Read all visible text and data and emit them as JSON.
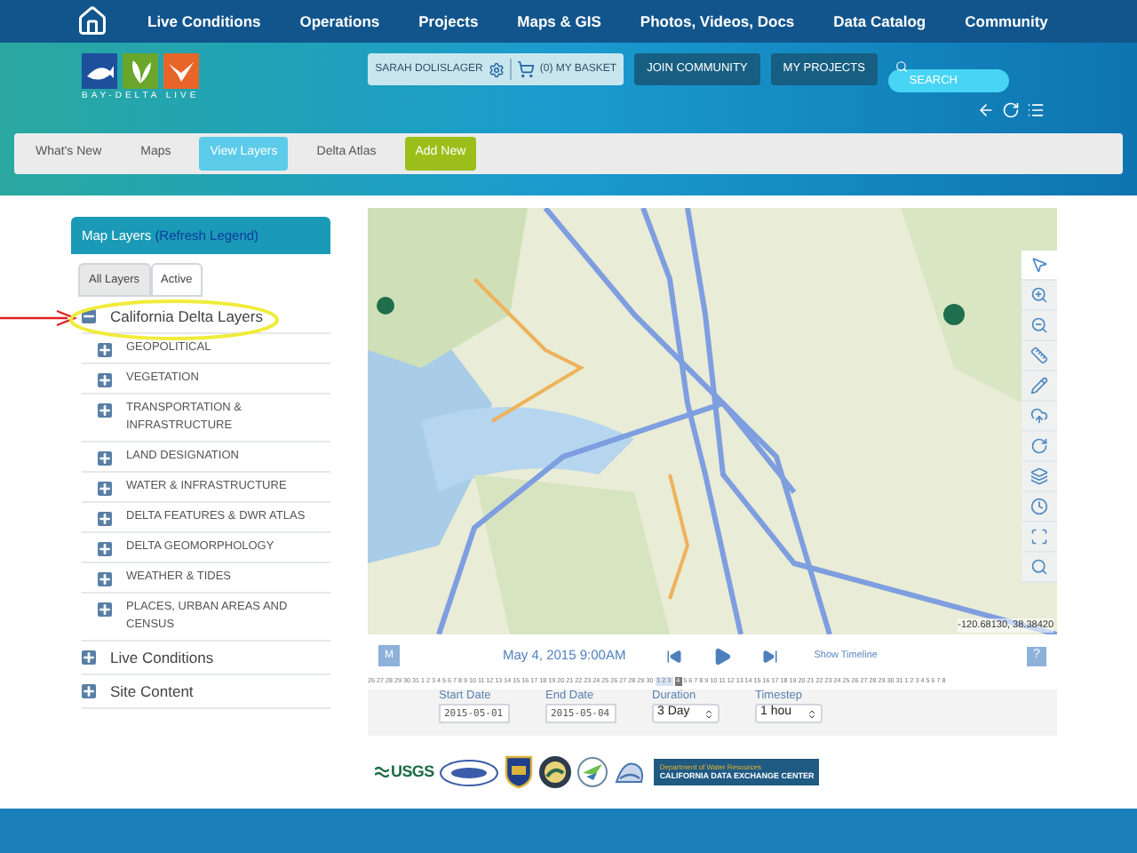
{
  "nav": {
    "items": [
      "Live Conditions",
      "Operations",
      "Projects",
      "Maps & GIS",
      "Photos, Videos, Docs",
      "Data Catalog",
      "Community"
    ]
  },
  "logo": {
    "caption": "BAY-DELTA LIVE"
  },
  "user_bar": {
    "user": "SARAH DOLISLAGER",
    "basket": "(0) MY BASKET"
  },
  "header_buttons": [
    "JOIN COMMUNITY",
    "MY PROJECTS"
  ],
  "search": {
    "placeholder": "SEARCH"
  },
  "tabs": [
    {
      "label": "What's New",
      "selected": false,
      "kind": "tab"
    },
    {
      "label": "Maps",
      "selected": false,
      "kind": "tab"
    },
    {
      "label": "View Layers",
      "selected": true,
      "kind": "tab"
    },
    {
      "label": "Delta Atlas",
      "selected": false,
      "kind": "tab"
    },
    {
      "label": "Add New",
      "kind": "action"
    }
  ],
  "sidebar": {
    "title": "Map Layers",
    "link": "(Refresh Legend)",
    "tabs": [
      {
        "label": "All Layers",
        "selected": true
      },
      {
        "label": "Active",
        "selected": false
      }
    ],
    "tree": [
      {
        "label": "California Delta Layers",
        "expanded": true,
        "children": [
          {
            "label": "GEOPOLITICAL",
            "expanded": false
          },
          {
            "label": "VEGETATION",
            "expanded": false
          },
          {
            "label": "TRANSPORTATION & INFRASTRUCTURE",
            "expanded": false
          },
          {
            "label": "LAND DESIGNATION",
            "expanded": false
          },
          {
            "label": "WATER & INFRASTRUCTURE",
            "expanded": false
          },
          {
            "label": "DELTA FEATURES & DWR ATLAS",
            "expanded": false
          },
          {
            "label": "DELTA GEOMORPHOLOGY",
            "expanded": false
          },
          {
            "label": "WEATHER & TIDES",
            "expanded": false
          },
          {
            "label": "PLACES, URBAN AREAS AND CENSUS",
            "expanded": false
          }
        ]
      },
      {
        "label": "Live Conditions",
        "expanded": false
      },
      {
        "label": "Site Content",
        "expanded": false
      }
    ]
  },
  "map": {
    "kind": "picture",
    "coordinates": "-120.68130, 38.38420",
    "tools": [
      {
        "kind": "select",
        "selected": true
      },
      {
        "kind": "zoom-in",
        "selected": false
      },
      {
        "kind": "zoom-out",
        "selected": false
      },
      {
        "kind": "measure",
        "selected": false
      },
      {
        "kind": "draw",
        "selected": false
      },
      {
        "kind": "upload",
        "selected": false
      },
      {
        "kind": "refresh",
        "selected": false
      },
      {
        "kind": "layers",
        "selected": false
      },
      {
        "kind": "time",
        "selected": false
      },
      {
        "kind": "extent",
        "selected": false
      },
      {
        "kind": "search",
        "selected": false
      }
    ]
  },
  "player": {
    "mode_button": "M",
    "datetime": "May 4, 2015 9:00AM",
    "timeline_link": "Show Timeline",
    "help_button": "?"
  },
  "timeline": {
    "before": "26 27 28 29 30 31 1 2 3 4 5 6 7 8 9 10 11 12 13 14 15 16 17 18 19 20 21 22 23 24 25 26 27 28 29 30",
    "range": "1 2 3",
    "current": "4",
    "after": "5 6 7 8 9 10 11 12 13 14 15 16 17 18 19 20 21 22 23 24 25 26 27 28 29 30 31 1 2 3 4 5 6 7 8"
  },
  "settings": [
    {
      "label": "Start Date",
      "value": "2015-05-01",
      "kind": "date"
    },
    {
      "label": "End Date",
      "value": "2015-05-04",
      "kind": "date"
    },
    {
      "label": "Duration",
      "value": "3 Day",
      "kind": "select"
    },
    {
      "label": "Timestep",
      "value": "1 hou",
      "kind": "select"
    }
  ],
  "partners": {
    "usgs": "USGS",
    "dwr_line1": "Department of Water Resources",
    "dwr_line2": "CALIFORNIA DATA EXCHANGE CENTER"
  }
}
